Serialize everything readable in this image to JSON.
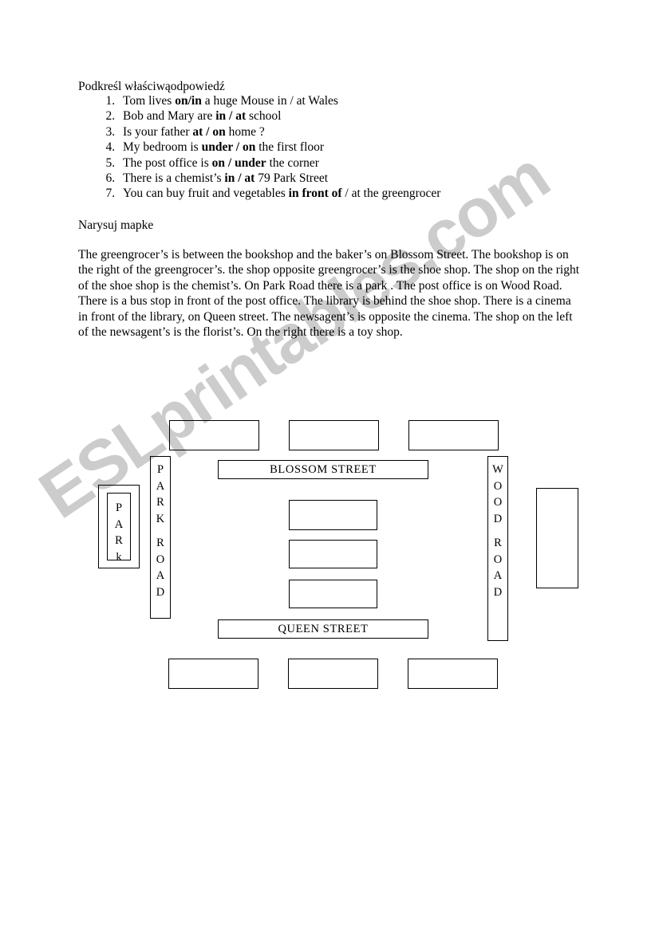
{
  "worksheet": {
    "instruction_1": "Podkreśl właściwąodpowiedź",
    "instruction_2": "Narysuj mapke",
    "exercises": [
      {
        "before": "Tom lives ",
        "bold": "on/in",
        "after": " a huge Mouse in / at Wales"
      },
      {
        "before": "Bob and Mary are ",
        "bold": "in / at",
        "after": " school"
      },
      {
        "before": "Is your father ",
        "bold": "at / on",
        "after": " home ?"
      },
      {
        "before": "My bedroom is ",
        "bold": "under / on",
        "after": " the first floor"
      },
      {
        "before": "The post office is ",
        "bold": "on / under",
        "after": " the corner"
      },
      {
        "before": "There is a chemist’s ",
        "bold": "in / at",
        "after": " 79 Park Street"
      },
      {
        "before": "You can buy fruit and vegetables ",
        "bold": "in front of",
        "after": " / at the greengrocer"
      }
    ],
    "story": "The greengrocer’s is between the bookshop and the baker’s on Blossom Street. The bookshop is on the right of the greengrocer’s. the shop opposite greengrocer’s is the shoe shop. The shop on the right of the shoe shop is the chemist’s. On Park Road there is a park . The post office is on Wood Road. There is a bus stop in front of the post office. The library is behind the shoe shop. There is a cinema in front of the library, on Queen street. The newsagent’s is opposite the cinema. The shop on the left of the newsagent’s is the florist’s. On the right there is a toy shop."
  },
  "map": {
    "park_label": "PARk",
    "park_road_label": "PARK ROAD",
    "wood_road_label": "WOOD ROAD",
    "blossom_street_label": "BLOSSOM STREET",
    "queen_street_label": "QUEEN STREET",
    "empty_boxes_top": [
      "",
      "",
      ""
    ],
    "empty_boxes_middle": [
      "",
      "",
      ""
    ],
    "empty_boxes_bottom": [
      "",
      "",
      ""
    ],
    "empty_box_right": ""
  },
  "watermark": {
    "text": "ESLprintables.com",
    "color": "#cccccc"
  }
}
